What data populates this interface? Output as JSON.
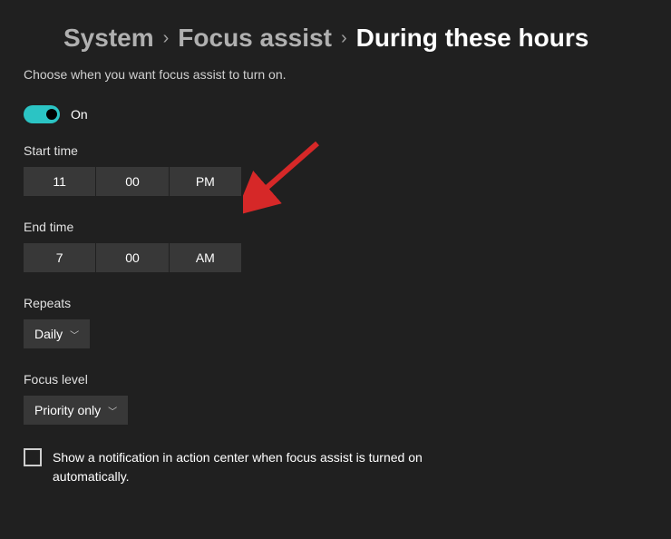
{
  "breadcrumb": {
    "system": "System",
    "focus_assist": "Focus assist",
    "current": "During these hours"
  },
  "description": "Choose when you want focus assist to turn on.",
  "toggle": {
    "state_label": "On"
  },
  "start_time": {
    "label": "Start time",
    "hour": "11",
    "minute": "00",
    "period": "PM"
  },
  "end_time": {
    "label": "End time",
    "hour": "7",
    "minute": "00",
    "period": "AM"
  },
  "repeats": {
    "label": "Repeats",
    "value": "Daily"
  },
  "focus_level": {
    "label": "Focus level",
    "value": "Priority only"
  },
  "notification_checkbox": {
    "label": "Show a notification in action center when focus assist is turned on automatically."
  },
  "colors": {
    "accent": "#2bc4c4",
    "arrow": "#d62828"
  }
}
